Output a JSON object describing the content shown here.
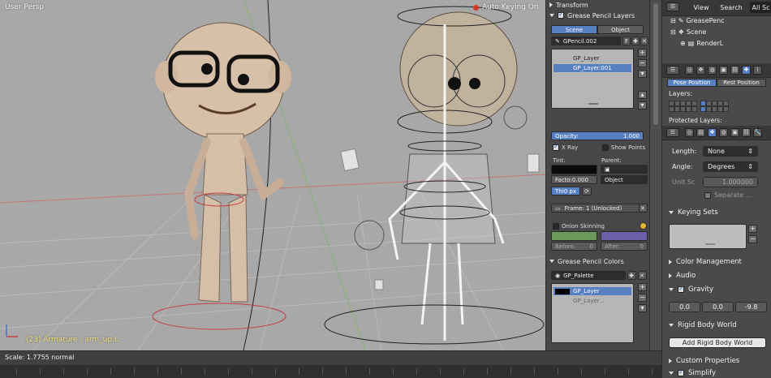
{
  "viewport": {
    "title": "User Persp",
    "status": "(23) Armature : arm_up.L",
    "auto_keying": "Auto Keying On"
  },
  "toolshelf": {
    "transform": "Transform",
    "gp_layers_title": "Grease Pencil Layers",
    "scene_tab": "Scene",
    "object_tab": "Object",
    "pencil_name": "GPencil.002",
    "pencil_f": "F",
    "layers": [
      {
        "name": "GP_Layer",
        "selected": false
      },
      {
        "name": "GP_Layer.001",
        "selected": true
      }
    ],
    "opacity_label": "Opacity:",
    "opacity_value": "1.000",
    "xray": "X Ray",
    "show_points": "Show Points",
    "tint_label": "Tint:",
    "parent_label": "Parent:",
    "factor": "Facto:0.000",
    "parent_value": "Object",
    "thickness": "Thi",
    "thickness_unit": "0 px",
    "frame": "Frame: 1 (Unlocked)",
    "onion": "Onion Skinning",
    "before": "Before:",
    "before_val": "0",
    "after": "After:",
    "after_val": "0",
    "gp_colors_title": "Grease Pencil Colors",
    "palette": "GP_Palette",
    "colors": [
      {
        "name": "GP_Layer",
        "selected": true
      },
      {
        "name": "GP_Layer...",
        "selected": false
      }
    ]
  },
  "outliner": {
    "view": "View",
    "search": "Search",
    "all_scenes": "All Sc",
    "items": [
      "GreasePenc",
      "Scene",
      "RenderL"
    ]
  },
  "properties": {
    "pose_position": "Pose Position",
    "rest_position": "Rest Position",
    "layers": "Layers:",
    "protected_layers": "Protected Layers:",
    "length_label": "Length:",
    "length_value": "None",
    "angle_label": "Angle:",
    "angle_value": "Degrees",
    "unit_scale_label": "Unit Sc",
    "unit_scale_value": "1.000000",
    "separate": "Separate ...",
    "keying_sets": "Keying Sets",
    "color_management": "Color Management",
    "audio": "Audio",
    "gravity": "Gravity",
    "gravity_x": "0.0",
    "gravity_y": "0.0",
    "gravity_z": "-9.8",
    "rigid_body_world": "Rigid Body World",
    "add_rigid_body_world": "Add Rigid Body World",
    "custom_properties": "Custom Properties",
    "simplify": "Simplify"
  },
  "hud": {
    "scale": "Scale: 1.7755 normal"
  },
  "colors": {
    "accent": "#5680c2",
    "viewport_bg": "#a8a8a8",
    "panel_bg": "#474747"
  }
}
